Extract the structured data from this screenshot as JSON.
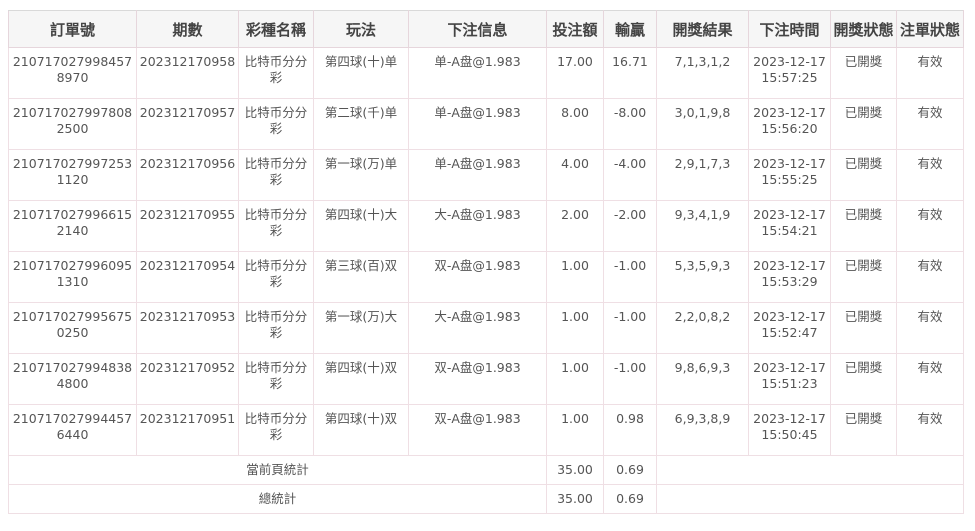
{
  "table": {
    "headers": [
      "訂單號",
      "期數",
      "彩種名稱",
      "玩法",
      "下注信息",
      "投注額",
      "輸贏",
      "開獎結果",
      "下注時間",
      "開獎狀態",
      "注單狀態"
    ],
    "rows": [
      {
        "order": "2107170279984578970",
        "period": "202312170958",
        "lottery": "比特币分分彩",
        "play": "第四球(十)单",
        "bet_info": "单-A盘@1.983",
        "amount": "17.00",
        "winloss": "16.71",
        "result": "7,1,3,1,2",
        "time": "2023-12-17 15:57:25",
        "draw_status": "已開獎",
        "bet_status": "有效"
      },
      {
        "order": "2107170279978082500",
        "period": "202312170957",
        "lottery": "比特币分分彩",
        "play": "第二球(千)单",
        "bet_info": "单-A盘@1.983",
        "amount": "8.00",
        "winloss": "-8.00",
        "result": "3,0,1,9,8",
        "time": "2023-12-17 15:56:20",
        "draw_status": "已開獎",
        "bet_status": "有效"
      },
      {
        "order": "2107170279972531120",
        "period": "202312170956",
        "lottery": "比特币分分彩",
        "play": "第一球(万)单",
        "bet_info": "单-A盘@1.983",
        "amount": "4.00",
        "winloss": "-4.00",
        "result": "2,9,1,7,3",
        "time": "2023-12-17 15:55:25",
        "draw_status": "已開獎",
        "bet_status": "有效"
      },
      {
        "order": "2107170279966152140",
        "period": "202312170955",
        "lottery": "比特币分分彩",
        "play": "第四球(十)大",
        "bet_info": "大-A盘@1.983",
        "amount": "2.00",
        "winloss": "-2.00",
        "result": "9,3,4,1,9",
        "time": "2023-12-17 15:54:21",
        "draw_status": "已開獎",
        "bet_status": "有效"
      },
      {
        "order": "2107170279960951310",
        "period": "202312170954",
        "lottery": "比特币分分彩",
        "play": "第三球(百)双",
        "bet_info": "双-A盘@1.983",
        "amount": "1.00",
        "winloss": "-1.00",
        "result": "5,3,5,9,3",
        "time": "2023-12-17 15:53:29",
        "draw_status": "已開獎",
        "bet_status": "有效"
      },
      {
        "order": "2107170279956750250",
        "period": "202312170953",
        "lottery": "比特币分分彩",
        "play": "第一球(万)大",
        "bet_info": "大-A盘@1.983",
        "amount": "1.00",
        "winloss": "-1.00",
        "result": "2,2,0,8,2",
        "time": "2023-12-17 15:52:47",
        "draw_status": "已開獎",
        "bet_status": "有效"
      },
      {
        "order": "2107170279948384800",
        "period": "202312170952",
        "lottery": "比特币分分彩",
        "play": "第四球(十)双",
        "bet_info": "双-A盘@1.983",
        "amount": "1.00",
        "winloss": "-1.00",
        "result": "9,8,6,9,3",
        "time": "2023-12-17 15:51:23",
        "draw_status": "已開獎",
        "bet_status": "有效"
      },
      {
        "order": "2107170279944576440",
        "period": "202312170951",
        "lottery": "比特币分分彩",
        "play": "第四球(十)双",
        "bet_info": "双-A盘@1.983",
        "amount": "1.00",
        "winloss": "0.98",
        "result": "6,9,3,8,9",
        "time": "2023-12-17 15:50:45",
        "draw_status": "已開獎",
        "bet_status": "有效"
      }
    ],
    "summary": [
      {
        "label": "當前頁統計",
        "amount": "35.00",
        "winloss": "0.69"
      },
      {
        "label": "總統計",
        "amount": "35.00",
        "winloss": "0.69"
      }
    ]
  }
}
